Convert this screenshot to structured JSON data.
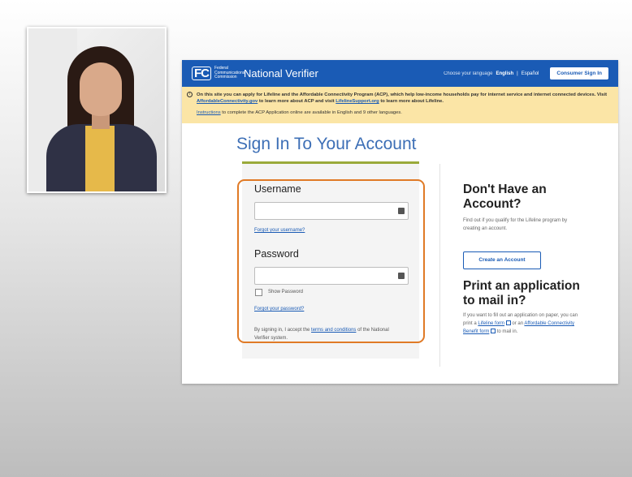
{
  "header": {
    "logo": "FC",
    "agency": "Federal Communications Commission",
    "site_title": "National Verifier",
    "language_prompt": "Choose your language",
    "language_english": "English",
    "language_separator": "|",
    "language_spanish": "Español",
    "consumer_sign_in": "Consumer Sign In",
    "brand_color": "#1a5bb5"
  },
  "banner": {
    "text_1": "On this site you can apply for Lifeline and the Affordable Connectivity Program (ACP), which help low-income households pay for internet service and internet connected devices. Visit ",
    "link_1": "AffordableConnectivity.gov",
    "text_2": " to learn more about ACP and visit ",
    "link_2": "LifelineSupport.org",
    "text_3": " to learn more about Lifeline.",
    "instructions_link": "Instructions",
    "instructions_text": " to complete the ACP Application online are available in English and 9 other languages.",
    "icon": "info-icon"
  },
  "signin": {
    "title": "Sign In To Your Account",
    "username_label": "Username",
    "username_value": "",
    "forgot_username": "Forgot your username?",
    "password_label": "Password",
    "password_value": "",
    "show_password": "Show Password",
    "forgot_password": "Forgot your password?",
    "accept_1": "By signing in, I accept the ",
    "accept_link": "terms and conditions",
    "accept_2": " of the National Verifier system.",
    "highlight_color": "#e07a26"
  },
  "aside": {
    "no_account_heading": "Don't Have an Account?",
    "no_account_text": "Find out if you qualify for the Lifeline program by creating an account.",
    "create_button": "Create an Account",
    "print_heading": "Print an application to mail in?",
    "print_text_1": "If you want to fill out an application on paper, you can print a ",
    "lifeline_form_link": "Lifeline form",
    "print_text_2": " or an ",
    "acp_form_link": "Affordable Connectivity Benefit form",
    "print_text_3": " to mail in."
  }
}
